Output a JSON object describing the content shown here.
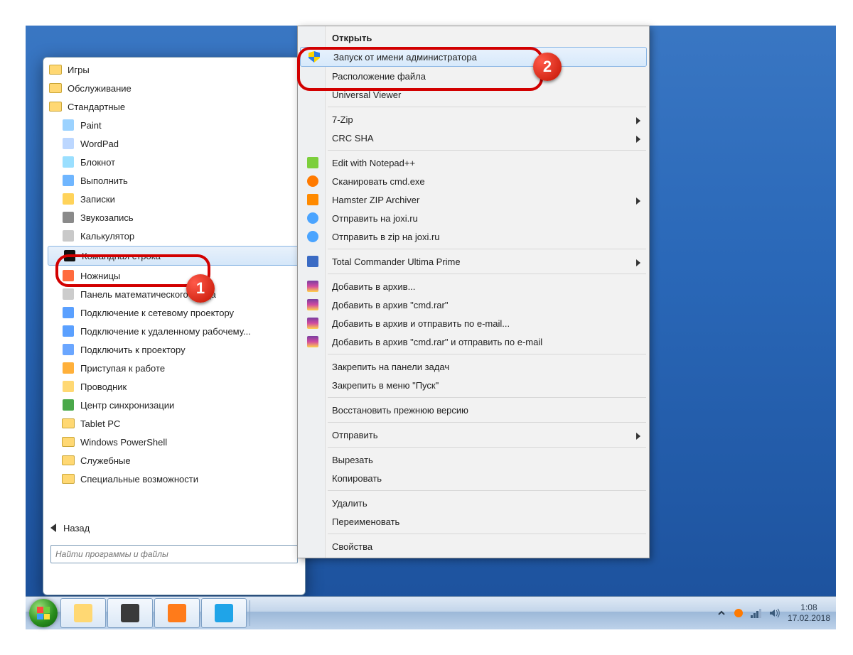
{
  "start_menu": {
    "folders_top": [
      "Игры",
      "Обслуживание",
      "Стандартные"
    ],
    "apps": [
      {
        "label": "Paint",
        "color": "#9bd2ff"
      },
      {
        "label": "WordPad",
        "color": "#bcd7ff"
      },
      {
        "label": "Блокнот",
        "color": "#9adfff"
      },
      {
        "label": "Выполнить",
        "color": "#6fb6ff"
      },
      {
        "label": "Записки",
        "color": "#ffd35a"
      },
      {
        "label": "Звукозапись",
        "color": "#8a8a8a"
      },
      {
        "label": "Калькулятор",
        "color": "#c9c9c9"
      },
      {
        "label": "Командная строка",
        "color": "#111",
        "selected": true
      },
      {
        "label": "Ножницы",
        "color": "#ff6a3d"
      },
      {
        "label": "Панель математического ввода",
        "color": "#cccccc"
      },
      {
        "label": "Подключение к сетевому проектору",
        "color": "#5aa0ff"
      },
      {
        "label": "Подключение к удаленному рабочему...",
        "color": "#5aa0ff"
      },
      {
        "label": "Подключить к проектору",
        "color": "#6aa6ff"
      },
      {
        "label": "Приступая к работе",
        "color": "#ffb03a"
      },
      {
        "label": "Проводник",
        "color": "#ffd873"
      },
      {
        "label": "Центр синхронизации",
        "color": "#4aa84a"
      }
    ],
    "subfolders": [
      "Tablet PC",
      "Windows PowerShell",
      "Служебные",
      "Специальные возможности"
    ],
    "back_label": "Назад",
    "search_placeholder": "Найти программы и файлы"
  },
  "context_menu": {
    "groups": [
      [
        {
          "label": "Открыть",
          "bold": true
        },
        {
          "label": "Запуск от имени администратора",
          "icon": "shield",
          "hover": true
        },
        {
          "label": "Расположение файла"
        },
        {
          "label": "Universal Viewer"
        }
      ],
      [
        {
          "label": "7-Zip",
          "sub": true
        },
        {
          "label": "CRC SHA",
          "sub": true
        }
      ],
      [
        {
          "label": "Edit with Notepad++",
          "icon": "npp"
        },
        {
          "label": "Сканировать cmd.exe",
          "icon": "avast"
        },
        {
          "label": "Hamster ZIP Archiver",
          "icon": "hamster",
          "sub": true
        },
        {
          "label": "Отправить на joxi.ru",
          "icon": "joxi"
        },
        {
          "label": "Отправить в zip на joxi.ru",
          "icon": "joxi"
        }
      ],
      [
        {
          "label": "Total Commander Ultima Prime",
          "icon": "tc",
          "sub": true
        }
      ],
      [
        {
          "label": "Добавить в архив...",
          "icon": "rar"
        },
        {
          "label": "Добавить в архив \"cmd.rar\"",
          "icon": "rar"
        },
        {
          "label": "Добавить в архив и отправить по e-mail...",
          "icon": "rar"
        },
        {
          "label": "Добавить в архив \"cmd.rar\" и отправить по e-mail",
          "icon": "rar"
        }
      ],
      [
        {
          "label": "Закрепить на панели задач"
        },
        {
          "label": "Закрепить в меню \"Пуск\""
        }
      ],
      [
        {
          "label": "Восстановить прежнюю версию"
        }
      ],
      [
        {
          "label": "Отправить",
          "sub": true
        }
      ],
      [
        {
          "label": "Вырезать"
        },
        {
          "label": "Копировать"
        }
      ],
      [
        {
          "label": "Удалить"
        },
        {
          "label": "Переименовать"
        }
      ],
      [
        {
          "label": "Свойства"
        }
      ]
    ]
  },
  "annotations": {
    "badge1": "1",
    "badge2": "2"
  },
  "taskbar": {
    "buttons": [
      {
        "name": "explorer",
        "color": "#ffd873"
      },
      {
        "name": "panda",
        "color": "#3a3a3a"
      },
      {
        "name": "firefox",
        "color": "#ff7b1a"
      },
      {
        "name": "skype",
        "color": "#1fa4e8"
      }
    ],
    "time": "1:08",
    "date": "17.02.2018"
  }
}
